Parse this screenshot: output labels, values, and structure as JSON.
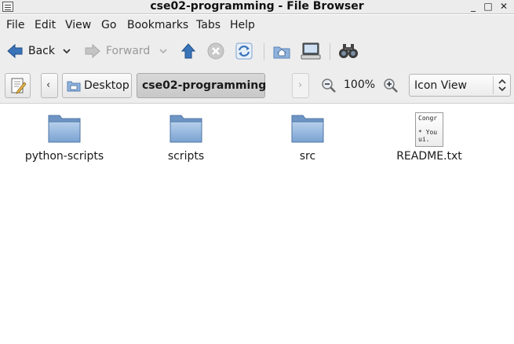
{
  "window": {
    "title": "cse02-programming - File Browser",
    "buttons": {
      "minimize": "_",
      "maximize": "□",
      "close": "✕"
    }
  },
  "menubar": {
    "items": [
      "File",
      "Edit",
      "View",
      "Go",
      "Bookmarks",
      "Tabs",
      "Help"
    ]
  },
  "toolbar": {
    "back_label": "Back",
    "forward_label": "Forward",
    "icons": [
      "back-arrow-icon",
      "forward-arrow-icon",
      "up-arrow-icon",
      "stop-icon",
      "reload-icon",
      "home-icon",
      "computer-icon",
      "search-binoculars-icon"
    ]
  },
  "location": {
    "breadcrumbs": [
      "Desktop",
      "cse02-programming"
    ],
    "zoom_level": "100%",
    "view_mode": "Icon View"
  },
  "files": [
    {
      "name": "python-scripts",
      "type": "folder"
    },
    {
      "name": "scripts",
      "type": "folder"
    },
    {
      "name": "src",
      "type": "folder"
    },
    {
      "name": "README.txt",
      "type": "text",
      "preview": "Congr\n\n* You\nui."
    }
  ],
  "colors": {
    "folder": "#8fb3dc",
    "accent": "#3a74b8"
  }
}
